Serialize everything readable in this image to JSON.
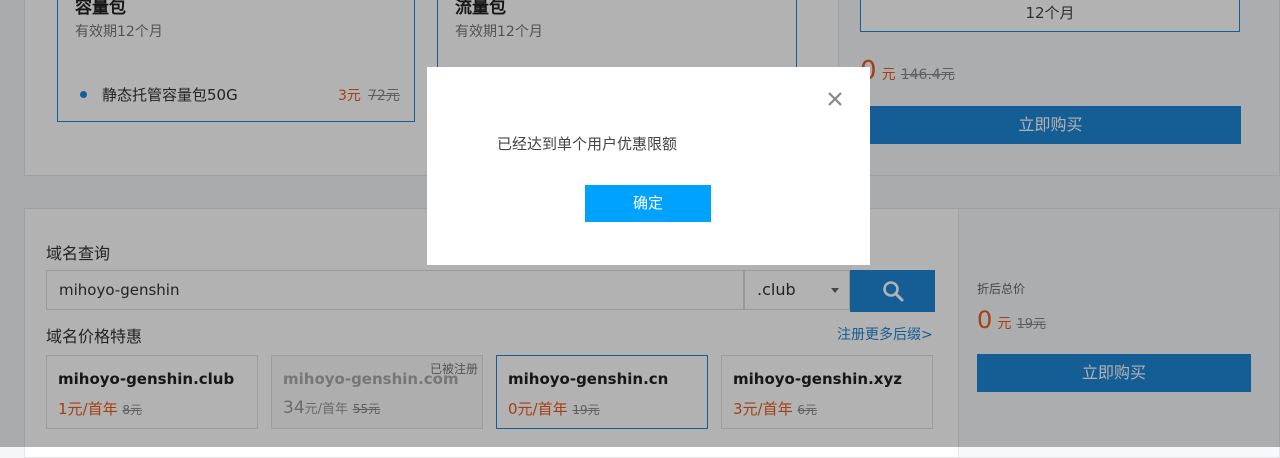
{
  "packages": [
    {
      "title": "容量包",
      "subtitle": "有效期12个月",
      "item": "静态托管容量包50G",
      "price": "3元",
      "original_price": "72元"
    },
    {
      "title": "流量包",
      "subtitle": "有效期12个月"
    }
  ],
  "summary_top": {
    "duration": "12个月",
    "price_value": "0",
    "price_unit": "元",
    "original_price": "146.4元",
    "buy_label": "立即购买"
  },
  "domain_query": {
    "title": "域名查询",
    "input_value": "mihoyo-genshin",
    "suffix": ".club",
    "promo_title": "域名价格特惠",
    "more_link": "注册更多后缀>",
    "cards": [
      {
        "name": "mihoyo-genshin.club",
        "price": "1元/首年",
        "original": "8元",
        "registered": ""
      },
      {
        "name": "mihoyo-genshin.com",
        "price_value": "34",
        "price_unit": "元/首年",
        "original": "55元",
        "registered": "已被注册"
      },
      {
        "name": "mihoyo-genshin.cn",
        "price": "0元/首年",
        "original": "19元",
        "registered": ""
      },
      {
        "name": "mihoyo-genshin.xyz",
        "price": "3元/首年",
        "original": "6元",
        "registered": ""
      }
    ]
  },
  "summary_bottom": {
    "label": "折后总价",
    "price_value": "0",
    "price_unit": "元",
    "original_price": "19元",
    "buy_label": "立即购买"
  },
  "modal": {
    "message": "已经达到单个用户优惠限额",
    "confirm_label": "确定"
  },
  "colors": {
    "accent": "#1e87d6",
    "price": "#ea5b1c",
    "modal_button": "#00a2ff"
  }
}
